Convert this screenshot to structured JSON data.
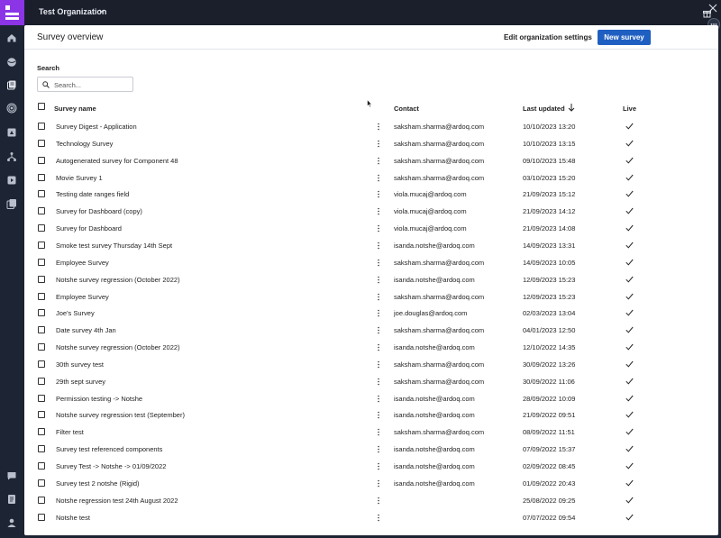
{
  "topbar": {
    "org_name": "Test Organization",
    "icons": [
      "logo",
      "chevron-down-icon",
      "close-icon",
      "gift-icon",
      "more-icon"
    ]
  },
  "sidebar": {
    "icons": [
      "home-icon",
      "globe-icon",
      "survey-icon",
      "broadcast-icon",
      "presentation-icon",
      "hierarchy-icon",
      "play-icon",
      "docs-icon",
      "chat-icon",
      "document-icon",
      "user-icon"
    ]
  },
  "header": {
    "title": "Survey overview",
    "edit_org_label": "Edit organization settings",
    "new_survey_label": "New survey"
  },
  "search": {
    "label": "Search",
    "placeholder": "Search..."
  },
  "table": {
    "columns": {
      "name": "Survey name",
      "contact": "Contact",
      "last_updated": "Last updated",
      "live": "Live"
    },
    "sort": {
      "column": "last_updated",
      "direction": "descending"
    },
    "rows": [
      {
        "name": "Survey Digest - Application",
        "contact": "saksham.sharma@ardoq.com",
        "updated": "10/10/2023 13:20",
        "live": true
      },
      {
        "name": "Technology Survey",
        "contact": "saksham.sharma@ardoq.com",
        "updated": "10/10/2023 13:15",
        "live": true
      },
      {
        "name": "Autogenerated survey for Component 48",
        "contact": "saksham.sharma@ardoq.com",
        "updated": "09/10/2023 15:48",
        "live": true
      },
      {
        "name": "Movie Survey 1",
        "contact": "saksham.sharma@ardoq.com",
        "updated": "03/10/2023 15:20",
        "live": true
      },
      {
        "name": "Testing date ranges field",
        "contact": "viola.mucaj@ardoq.com",
        "updated": "21/09/2023 15:12",
        "live": true
      },
      {
        "name": "Survey for Dashboard (copy)",
        "contact": "viola.mucaj@ardoq.com",
        "updated": "21/09/2023 14:12",
        "live": true
      },
      {
        "name": "Survey for Dashboard",
        "contact": "viola.mucaj@ardoq.com",
        "updated": "21/09/2023 14:08",
        "live": true
      },
      {
        "name": "Smoke test survey Thursday 14th Sept",
        "contact": "isanda.notshe@ardoq.com",
        "updated": "14/09/2023 13:31",
        "live": true
      },
      {
        "name": "Employee Survey",
        "contact": "saksham.sharma@ardoq.com",
        "updated": "14/09/2023 10:05",
        "live": true
      },
      {
        "name": "Notshe survey regression (October 2022)",
        "contact": "isanda.notshe@ardoq.com",
        "updated": "12/09/2023 15:23",
        "live": true
      },
      {
        "name": "Employee Survey",
        "contact": "saksham.sharma@ardoq.com",
        "updated": "12/09/2023 15:23",
        "live": true
      },
      {
        "name": "Joe's Survey",
        "contact": "joe.douglas@ardoq.com",
        "updated": "02/03/2023 13:04",
        "live": true
      },
      {
        "name": "Date survey 4th Jan",
        "contact": "saksham.sharma@ardoq.com",
        "updated": "04/01/2023 12:50",
        "live": true
      },
      {
        "name": "Notshe survey regression (October 2022)",
        "contact": "isanda.notshe@ardoq.com",
        "updated": "12/10/2022 14:35",
        "live": true
      },
      {
        "name": "30th survey test",
        "contact": "saksham.sharma@ardoq.com",
        "updated": "30/09/2022 13:26",
        "live": true
      },
      {
        "name": "29th sept survey",
        "contact": "saksham.sharma@ardoq.com",
        "updated": "30/09/2022 11:06",
        "live": true
      },
      {
        "name": "Permission testing -> Notshe",
        "contact": "isanda.notshe@ardoq.com",
        "updated": "28/09/2022 10:09",
        "live": true
      },
      {
        "name": "Notshe survey regression test (September)",
        "contact": "isanda.notshe@ardoq.com",
        "updated": "21/09/2022 09:51",
        "live": true
      },
      {
        "name": "Filter test",
        "contact": "saksham.sharma@ardoq.com",
        "updated": "08/09/2022 11:51",
        "live": true
      },
      {
        "name": "Survey test referenced components",
        "contact": "isanda.notshe@ardoq.com",
        "updated": "07/09/2022 15:37",
        "live": true
      },
      {
        "name": "Survey Test -> Notshe -> 01/09/2022",
        "contact": "isanda.notshe@ardoq.com",
        "updated": "02/09/2022 08:45",
        "live": true
      },
      {
        "name": "Survey test 2 notshe (Rigid)",
        "contact": "isanda.notshe@ardoq.com",
        "updated": "01/09/2022 20:43",
        "live": true
      },
      {
        "name": "Notshe regression test 24th August 2022",
        "contact": "",
        "updated": "25/08/2022 09:25",
        "live": true
      },
      {
        "name": "Notshe test",
        "contact": "",
        "updated": "07/07/2022 09:54",
        "live": true
      }
    ]
  }
}
